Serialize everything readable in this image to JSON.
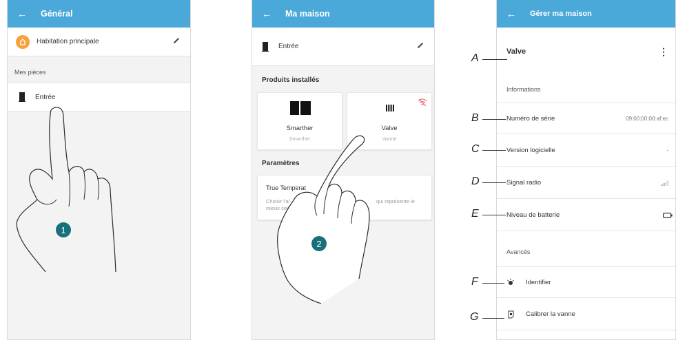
{
  "screen1": {
    "title": "Général",
    "home_label": "Habitation principale",
    "section": "Mes pièces",
    "room": "Entrée",
    "step": "1"
  },
  "screen2": {
    "title": "Ma maison",
    "room": "Entrée",
    "products_title": "Produits installés",
    "products": [
      {
        "name": "Smarther",
        "type": "Smarther"
      },
      {
        "name": "Valve",
        "type": "Vanne"
      }
    ],
    "params_title": "Paramètres",
    "param_card_title": "True Temperat",
    "param_card_desc_left": "Choisir l'al",
    "param_card_desc_left2": "mieux celi",
    "param_card_desc_right": "qui représente le",
    "step": "2"
  },
  "screen3": {
    "title": "Gérer ma maison",
    "device": "Valve",
    "info_title": "Informations",
    "rows": [
      {
        "letter": "B",
        "label": "Numéro de série",
        "value": "09:00:00:00:af:ec"
      },
      {
        "letter": "C",
        "label": "Version logicielle",
        "value": "-"
      },
      {
        "letter": "D",
        "label": "Signal radio",
        "value": ""
      },
      {
        "letter": "E",
        "label": "Niveau de batterie",
        "value": ""
      }
    ],
    "advanced_title": "Avancés",
    "identify": "Identifier",
    "calibrate": "Calibrer la vanne",
    "letter_a": "A",
    "letter_f": "F",
    "letter_g": "G"
  },
  "colors": {
    "appbar": "#4aa9d9",
    "badge": "#17707a",
    "home_icon": "#f7a13b",
    "offline_icon": "#e8707a"
  },
  "icons": [
    "back-arrow-icon",
    "pencil-icon",
    "home-icon",
    "door-icon",
    "thermostat-icon",
    "radiator-valve-icon",
    "wifi-off-icon",
    "kebab-menu-icon",
    "signal-icon",
    "battery-icon",
    "light-bulb-icon",
    "calibrate-icon"
  ]
}
